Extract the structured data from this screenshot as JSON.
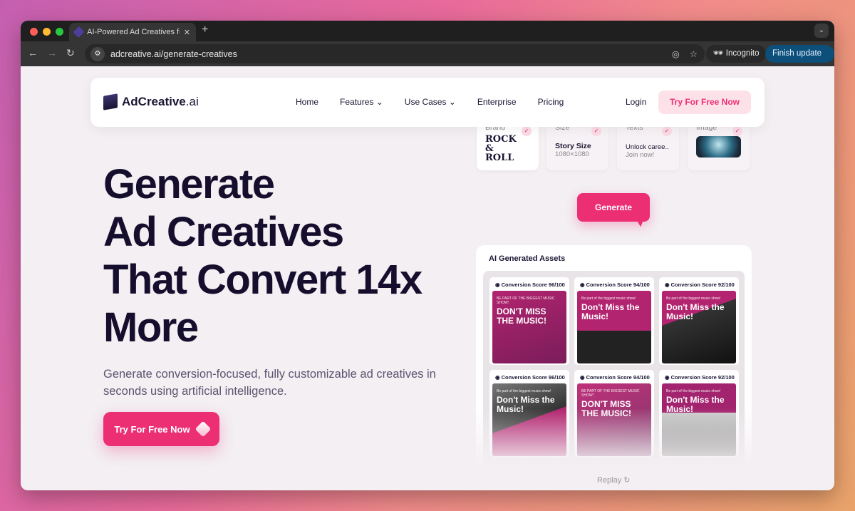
{
  "browser": {
    "tab_title": "AI-Powered Ad Creatives for B",
    "url": "adcreative.ai/generate-creatives",
    "incognito": "Incognito",
    "finish_update": "Finish update"
  },
  "nav": {
    "logo_bold": "AdCreative",
    "logo_light": ".ai",
    "links": [
      "Home",
      "Features",
      "Use Cases",
      "Enterprise",
      "Pricing"
    ],
    "login": "Login",
    "try": "Try For Free Now"
  },
  "hero": {
    "title_lines": [
      "Generate",
      "Ad Creatives",
      "That Convert 14x",
      "More"
    ],
    "subtitle": "Generate conversion-focused, fully customizable ad creatives in seconds using artificial intelligence.",
    "cta": "Try For Free Now"
  },
  "inputs": {
    "brand": {
      "label": "Brand",
      "logo": "ROCK & ROLL"
    },
    "size": {
      "label": "Size",
      "value": "Story Size",
      "dims": "1080×1080"
    },
    "texts": {
      "label": "Texts",
      "value": "Unlock caree..",
      "sub": "Join now!"
    },
    "image": {
      "label": "Image"
    }
  },
  "generate": "Generate",
  "assets": {
    "title": "AI Generated Assets",
    "items": [
      {
        "score": "Conversion Score 96/100",
        "small": "BE PART OF THE BIGGEST MUSIC SHOW!",
        "headline": "DON'T MISS THE MUSIC!"
      },
      {
        "score": "Conversion Score 94/100",
        "small": "Be part of the biggest music show!",
        "headline": "Don't Miss the Music!"
      },
      {
        "score": "Conversion Score 92/100",
        "small": "Be part of the biggest music show!",
        "headline": "Don't Miss the Music!"
      },
      {
        "score": "Conversion Score 96/100",
        "small": "Be part of the biggest music show!",
        "headline": "Don't Miss the Music!"
      },
      {
        "score": "Conversion Score 94/100",
        "small": "BE PART OF THE BIGGEST MUSIC SHOW!",
        "headline": "DON'T MISS THE MUSIC!"
      },
      {
        "score": "Conversion Score 92/100",
        "small": "Be part of the biggest music show!",
        "headline": "Don't Miss the Music!"
      }
    ]
  },
  "replay": "Replay ↻",
  "colors": {
    "accent": "#ec2f73",
    "ink": "#150f2d",
    "ad_magenta": "#a3246e"
  }
}
